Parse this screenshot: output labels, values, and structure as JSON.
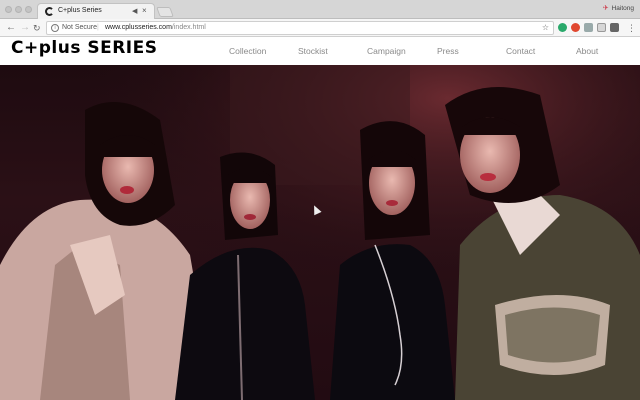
{
  "browser": {
    "tab_title": "C+plus Series",
    "profile_name": "Haitong",
    "security_label": "Not Secure",
    "url_host": "www.cplusseries.com",
    "url_path": "/index.html"
  },
  "site": {
    "logo_text": "C+plus SERIES",
    "nav": [
      "Collection",
      "Stockist",
      "Campaign",
      "Press",
      "Contact",
      "About"
    ]
  },
  "hero": {
    "description": "Campaign photo of four models in dark red lighting"
  },
  "colors": {
    "hero_bg": "#1e0b10",
    "nav_text": "#8a8a8a",
    "logo": "#000000"
  }
}
